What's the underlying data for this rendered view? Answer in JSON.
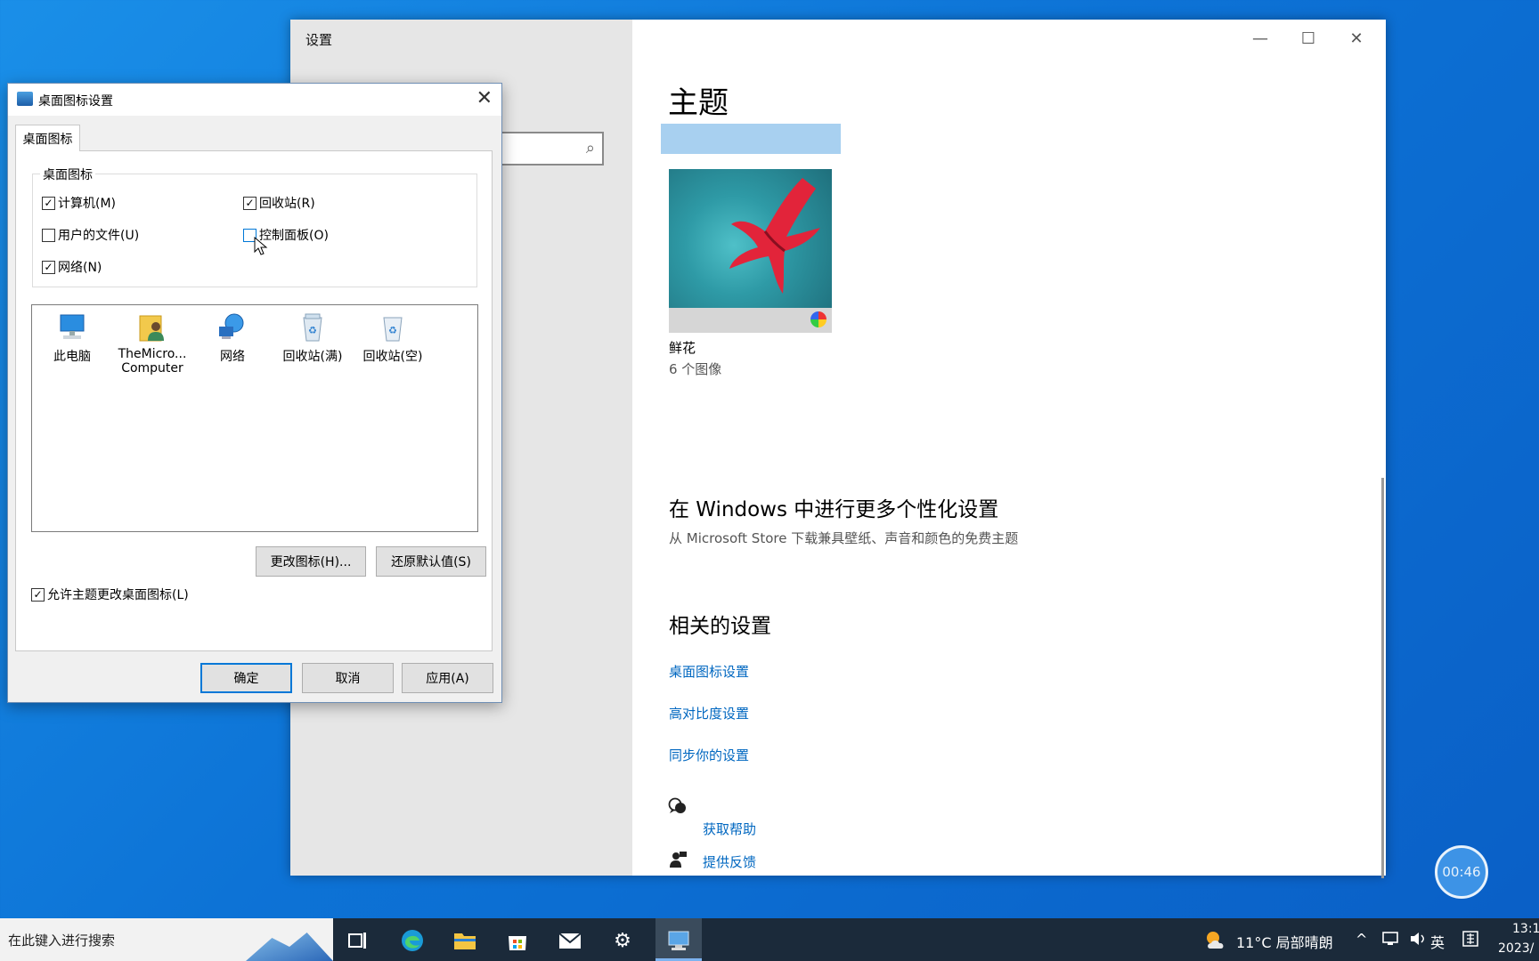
{
  "settings": {
    "title": "设置",
    "controls": {
      "minimize": "—",
      "maximize": "☐",
      "close": "✕"
    },
    "search_icon": "⌕",
    "heading": "主题",
    "theme": {
      "name": "鲜花",
      "count": "6 个图像"
    },
    "more": {
      "heading": "在 Windows 中进行更多个性化设置",
      "subtitle": "从 Microsoft Store 下载兼具壁纸、声音和颜色的免费主题"
    },
    "related": {
      "heading": "相关的设置",
      "links": [
        "桌面图标设置",
        "高对比度设置",
        "同步你的设置"
      ]
    },
    "help": {
      "get_help": "获取帮助",
      "feedback": "提供反馈"
    }
  },
  "dialog": {
    "title": "桌面图标设置",
    "close": "✕",
    "tab": "桌面图标",
    "group_label": "桌面图标",
    "checks": [
      {
        "label": "计算机(M)",
        "checked": true
      },
      {
        "label": "回收站(R)",
        "checked": true
      },
      {
        "label": "用户的文件(U)",
        "checked": false
      },
      {
        "label": "控制面板(O)",
        "checked": false
      },
      {
        "label": "网络(N)",
        "checked": true
      }
    ],
    "icons": [
      {
        "label": "此电脑",
        "icon": "computer-icon"
      },
      {
        "label": "TheMicro... Computer",
        "icon": "user-folder-icon"
      },
      {
        "label": "网络",
        "icon": "network-icon"
      },
      {
        "label": "回收站(满)",
        "icon": "recycle-bin-full-icon"
      },
      {
        "label": "回收站(空)",
        "icon": "recycle-bin-empty-icon"
      }
    ],
    "change_icon": "更改图标(H)...",
    "restore_default": "还原默认值(S)",
    "allow_theme": {
      "label": "允许主题更改桌面图标(L)",
      "checked": true
    },
    "ok": "确定",
    "cancel": "取消",
    "apply": "应用(A)"
  },
  "taskbar": {
    "search_placeholder": "在此键入进行搜索",
    "weather": "11°C 局部晴朗",
    "ime": "英",
    "time": "13:1",
    "date": "2023/"
  },
  "recording_timer": "00:46",
  "colors": {
    "link": "#0067c0",
    "accent": "#0078d7",
    "theme_bar": "#a8d0f0"
  }
}
